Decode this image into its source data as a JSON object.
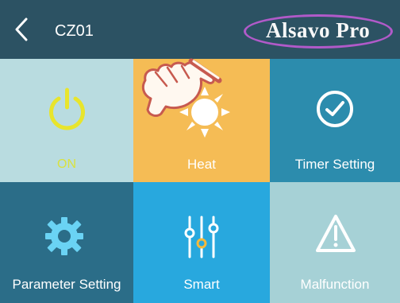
{
  "header": {
    "back_icon": "chevron-left-icon",
    "device_name": "CZ01",
    "brand_logo": "Alsavo Pro",
    "brand_color": "#f8f8f8",
    "brand_outline_color": "#b15ac9"
  },
  "tiles": [
    {
      "label": "ON",
      "icon": "power-icon",
      "background": "#b9dce0",
      "icon_color": "#e8e52c",
      "label_color": "#d9e23f"
    },
    {
      "label": "Heat",
      "icon": "sun-icon",
      "background": "#f5bc55",
      "icon_color": "#ffffff",
      "label_color": "#ffffff"
    },
    {
      "label": "Timer Setting",
      "icon": "clock-check-icon",
      "background": "#2c8cad",
      "icon_color": "#ffffff",
      "label_color": "#ffffff"
    },
    {
      "label": "Parameter Setting",
      "icon": "gear-icon",
      "background": "#2b6d88",
      "icon_color": "#6ad3f4",
      "label_color": "#ffffff"
    },
    {
      "label": "Smart",
      "icon": "sliders-icon",
      "background": "#28a8de",
      "icon_color": "#ffffff",
      "accent_color": "#f6b93a",
      "label_color": "#ffffff"
    },
    {
      "label": "Malfunction",
      "icon": "warning-icon",
      "background": "#a6d1d6",
      "icon_color": "#ffffff",
      "label_color": "#ffffff"
    }
  ],
  "overlay": {
    "icon": "pointing-hand-icon",
    "fill_color": "#fff8f0",
    "outline_color": "#c75a4f"
  }
}
